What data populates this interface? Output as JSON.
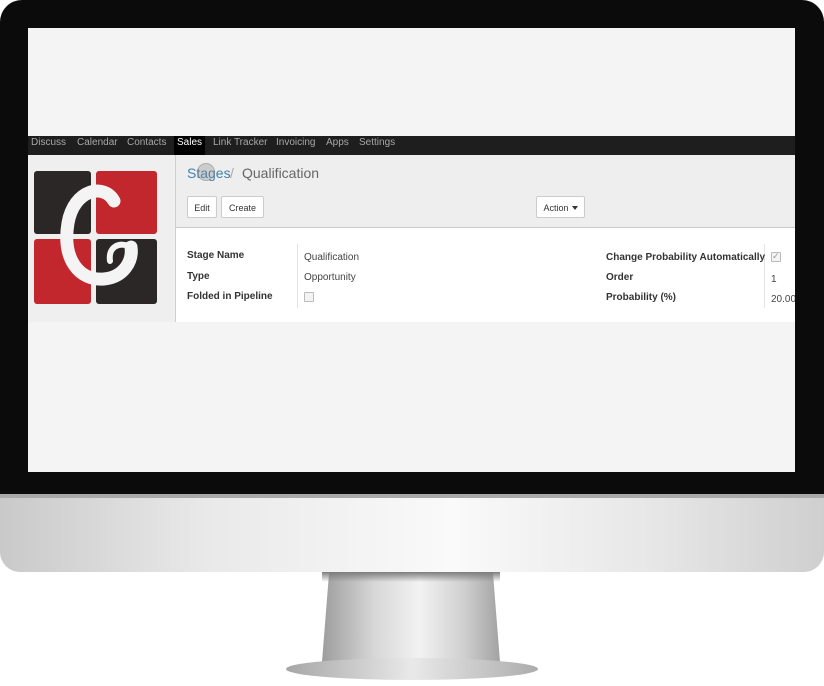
{
  "colors": {
    "brand_red": "#c1272d",
    "brand_dark": "#2b2727",
    "link_blue": "#3f7fb0",
    "nav_bg": "#1e1e1e"
  },
  "nav": {
    "items": [
      "Discuss",
      "Calendar",
      "Contacts",
      "Sales",
      "Link Tracker",
      "Invoicing",
      "Apps",
      "Settings"
    ],
    "active": "Sales"
  },
  "breadcrumb": {
    "parent": "Stages",
    "separator": "/",
    "current": "Qualification"
  },
  "buttons": {
    "edit": "Edit",
    "create": "Create",
    "action": "Action"
  },
  "form": {
    "left": [
      {
        "label": "Stage Name",
        "value": "Qualification"
      },
      {
        "label": "Type",
        "value": "Opportunity"
      },
      {
        "label": "Folded in Pipeline",
        "checked": false
      }
    ],
    "right": [
      {
        "label": "Change Probability Automatically",
        "checked": true,
        "check_glyph": "✓"
      },
      {
        "label": "Order",
        "value": "1"
      },
      {
        "label": "Probability (%)",
        "value": "20.00"
      }
    ]
  },
  "icons": {
    "logo": "company-logo",
    "dropdown": "caret-down-icon",
    "cursor": "mouse-cursor-icon"
  }
}
